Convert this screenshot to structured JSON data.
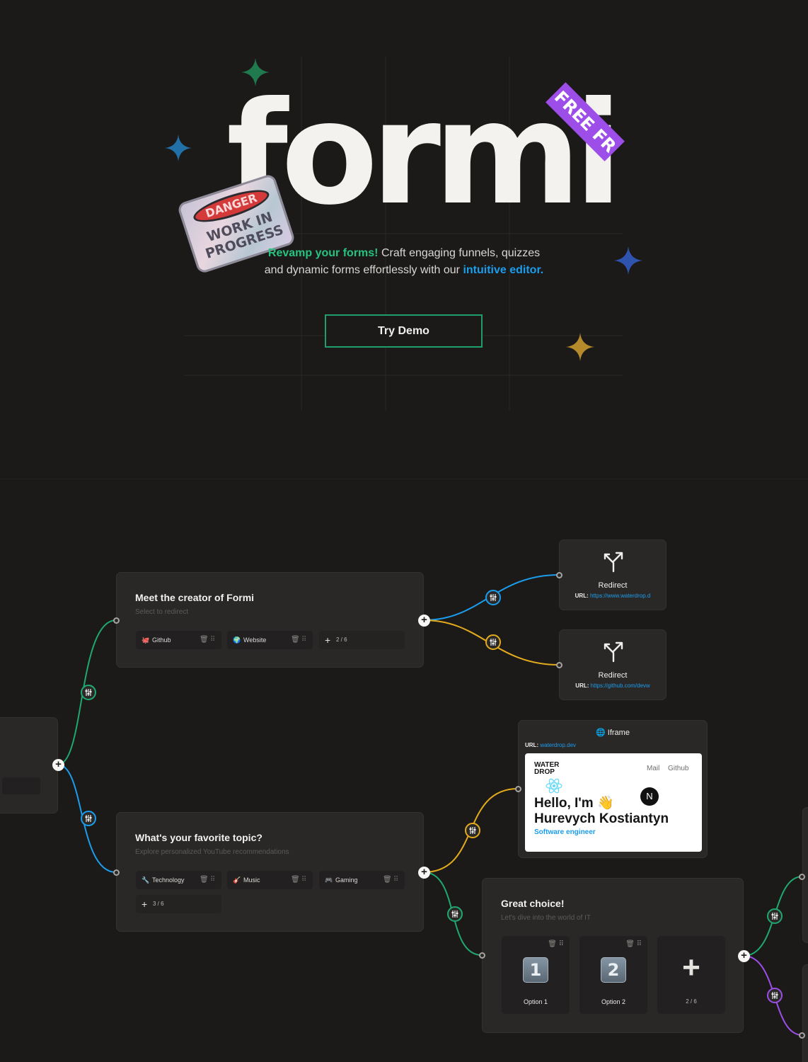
{
  "hero": {
    "logo": "formi",
    "free_tag": "FREE FR",
    "sticker": {
      "top": "DANGER",
      "bottom": "WORK IN PROGRESS"
    },
    "tagline": {
      "highlight1": "Revamp your forms!",
      "text1": " Craft engaging funnels, quizzes and dynamic forms effortlessly with our ",
      "highlight2": "intuitive editor."
    },
    "cta": "Try Demo",
    "colors": {
      "green": "#27c27f",
      "blue": "#1b9dec",
      "purple": "#9d4ee8",
      "gold": "#b48a2a"
    }
  },
  "flow": {
    "creator_card": {
      "title": "Meet the creator of Formi",
      "subtitle": "Select to redirect",
      "options": [
        {
          "icon": "github-icon",
          "emoji": "🐙",
          "label": "Github"
        },
        {
          "icon": "globe-icon",
          "emoji": "🌍",
          "label": "Website"
        }
      ],
      "add": {
        "symbol": "+",
        "count": "2 / 6"
      }
    },
    "redirects": [
      {
        "label": "Redirect",
        "url_label": "URL:",
        "url": "https://www.waterdrop.d"
      },
      {
        "label": "Redirect",
        "url_label": "URL:",
        "url": "https://github.com/devw"
      }
    ],
    "topic_card": {
      "title": "What's your favorite topic?",
      "subtitle": "Explore personalized YouTube recommendations",
      "options": [
        {
          "icon": "wrench-icon",
          "emoji": "🔧",
          "label": "Technology"
        },
        {
          "icon": "guitar-icon",
          "emoji": "🎸",
          "label": "Music"
        },
        {
          "icon": "gamepad-icon",
          "emoji": "🎮",
          "label": "Gaming"
        }
      ],
      "add": {
        "symbol": "+",
        "count": "3 / 6"
      }
    },
    "iframe": {
      "title": "Iframe",
      "url_label": "URL:",
      "url": "waterdrop.dev",
      "preview": {
        "logo_line1": "WATER",
        "logo_line2": "DROP",
        "nav": [
          "Mail",
          "Github"
        ],
        "hello": "Hello, I'm 👋",
        "name": "Hurevych Kostiantyn",
        "role": "Software engineer"
      }
    },
    "choice_card": {
      "title": "Great choice!",
      "subtitle": "Let's dive into the world of IT",
      "options": [
        {
          "number": "1",
          "label": "Option 1"
        },
        {
          "number": "2",
          "label": "Option 2"
        }
      ],
      "add": {
        "symbol": "+",
        "count": "2 / 6"
      }
    }
  }
}
